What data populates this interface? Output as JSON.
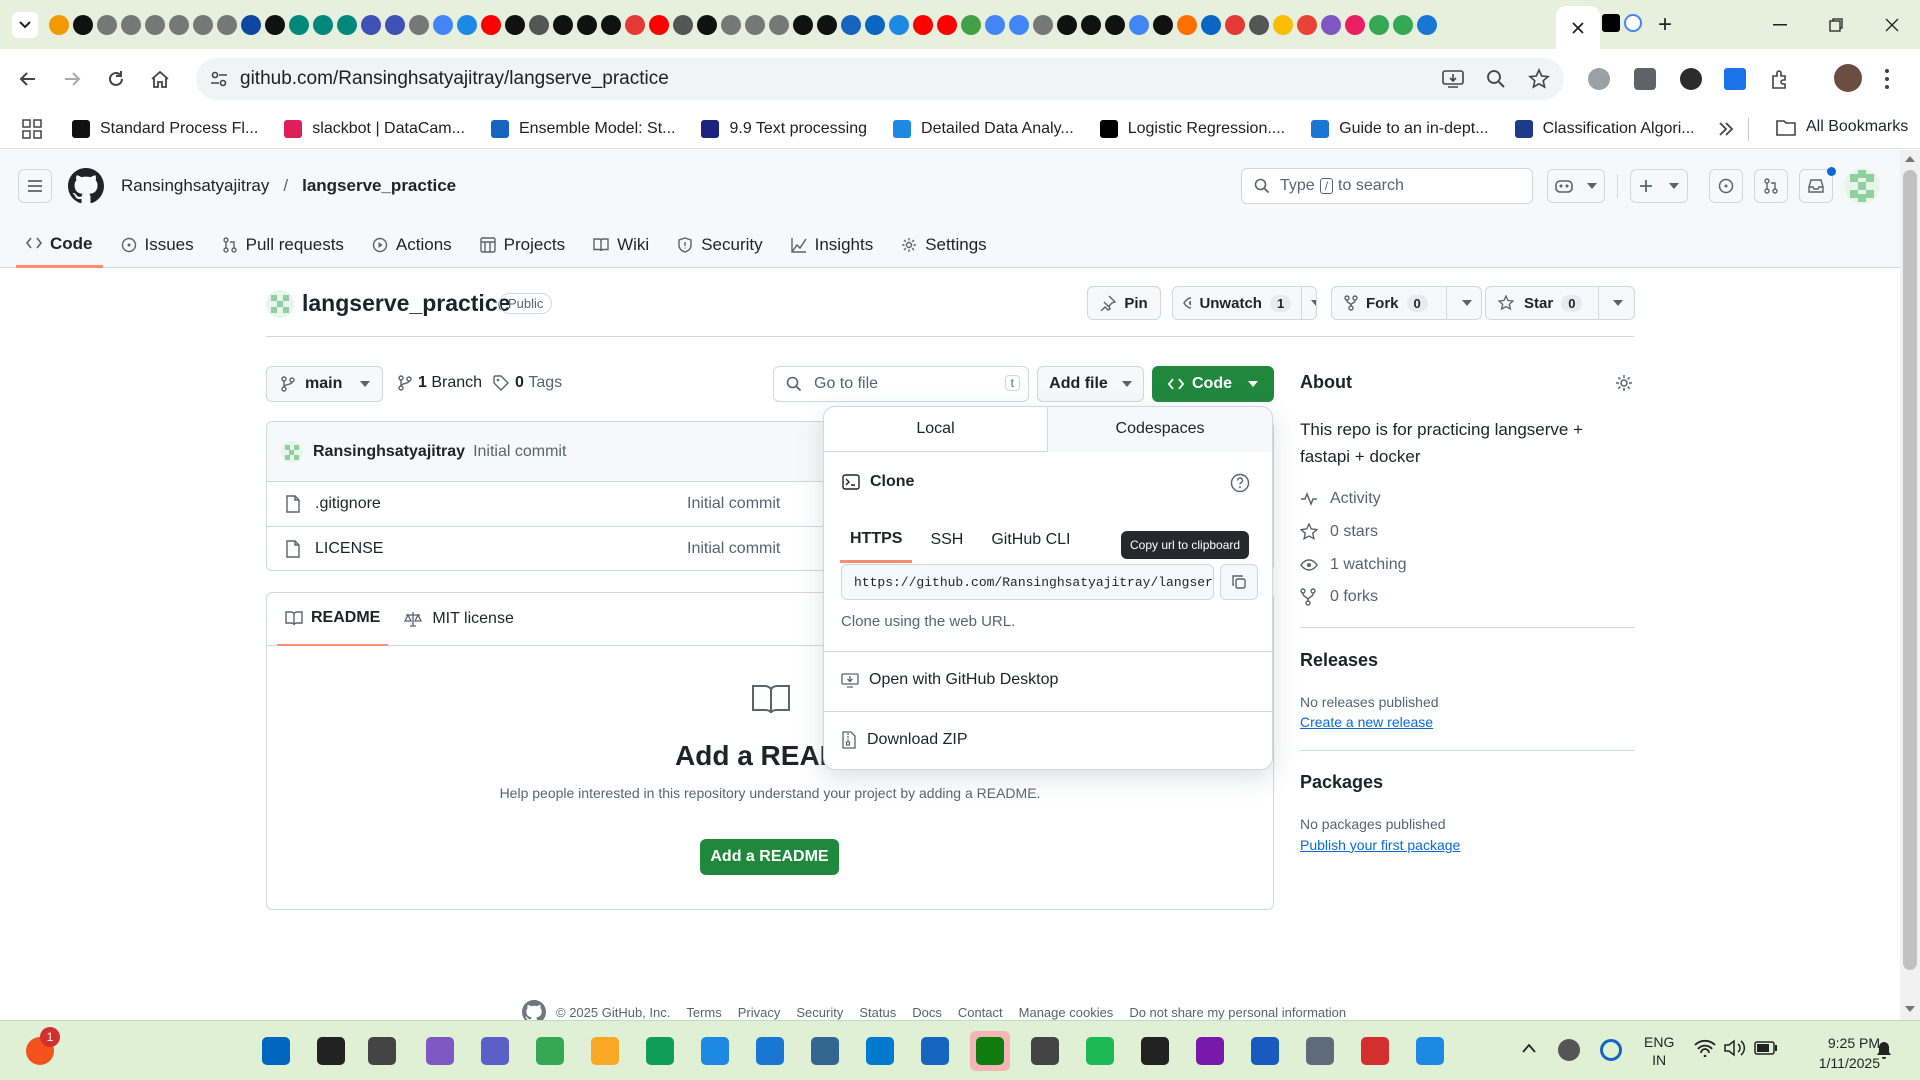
{
  "browser": {
    "url": "github.com/Ransinghsatyajitray/langserve_practice",
    "bookmarks": [
      {
        "label": "Standard Process Fl...",
        "color": "#111111"
      },
      {
        "label": "slackbot | DataCam...",
        "color": "#e01e5a"
      },
      {
        "label": "Ensemble Model: St...",
        "color": "#1565c0"
      },
      {
        "label": "9.9 Text processing",
        "color": "#1a237e"
      },
      {
        "label": "Detailed Data Analy...",
        "color": "#1e88e5"
      },
      {
        "label": "Logistic Regression....",
        "color": "#000000"
      },
      {
        "label": "Guide to an in-dept...",
        "color": "#1976d2"
      },
      {
        "label": "Classification Algori...",
        "color": "#1e3a8a"
      }
    ],
    "all_bookmarks_label": "All Bookmarks"
  },
  "github": {
    "owner": "Ransinghsatyajitray",
    "separator": "/",
    "repo": "langserve_practice",
    "search_prefix": "Type",
    "search_key": "/",
    "search_suffix": "to search",
    "tabs": [
      "Code",
      "Issues",
      "Pull requests",
      "Actions",
      "Projects",
      "Wiki",
      "Security",
      "Insights",
      "Settings"
    ],
    "visibility": "Public",
    "pin_label": "Pin",
    "unwatch_label": "Unwatch",
    "unwatch_count": "1",
    "fork_label": "Fork",
    "fork_count": "0",
    "star_label": "Star",
    "star_count": "0"
  },
  "repo": {
    "branch": "main",
    "branch_count": "1",
    "branch_label": "Branch",
    "tag_count": "0",
    "tag_label": "Tags",
    "go_to_file": "Go to file",
    "go_to_file_key": "t",
    "add_file": "Add file",
    "code_button": "Code",
    "commit_author": "Ransinghsatyajitray",
    "commit_message": "Initial commit",
    "files": [
      {
        "name": ".gitignore",
        "message": "Initial commit"
      },
      {
        "name": "LICENSE",
        "message": "Initial commit"
      }
    ],
    "readme_tab": "README",
    "license_tab": "MIT license",
    "readme_title": "Add a READ",
    "readme_help": "Help people interested in this repository understand your project by adding a README.",
    "add_readme_button": "Add a README"
  },
  "clone_popup": {
    "tab_local": "Local",
    "tab_codespaces": "Codespaces",
    "clone_label": "Clone",
    "protocols": [
      "HTTPS",
      "SSH",
      "GitHub CLI"
    ],
    "url_value": "https://github.com/Ransinghsatyajitray/langserve",
    "tooltip": "Copy url to clipboard",
    "hint": "Clone using the web URL.",
    "open_desktop": "Open with GitHub Desktop",
    "download_zip": "Download ZIP"
  },
  "about": {
    "title": "About",
    "description": "This repo is for practicing langserve + fastapi + docker",
    "activity": "Activity",
    "stars": "0 stars",
    "watching": "1 watching",
    "forks": "0 forks",
    "releases_title": "Releases",
    "releases_none": "No releases published",
    "releases_link": "Create a new release",
    "packages_title": "Packages",
    "packages_none": "No packages published",
    "packages_link": "Publish your first package"
  },
  "footer": {
    "copyright": "© 2025 GitHub, Inc.",
    "links": [
      "Terms",
      "Privacy",
      "Security",
      "Status",
      "Docs",
      "Contact",
      "Manage cookies",
      "Do not share my personal information"
    ]
  },
  "taskbar": {
    "notification_badge": "1",
    "language_line1": "ENG",
    "language_line2": "IN",
    "time": "9:25 PM",
    "date": "1/11/2025"
  }
}
